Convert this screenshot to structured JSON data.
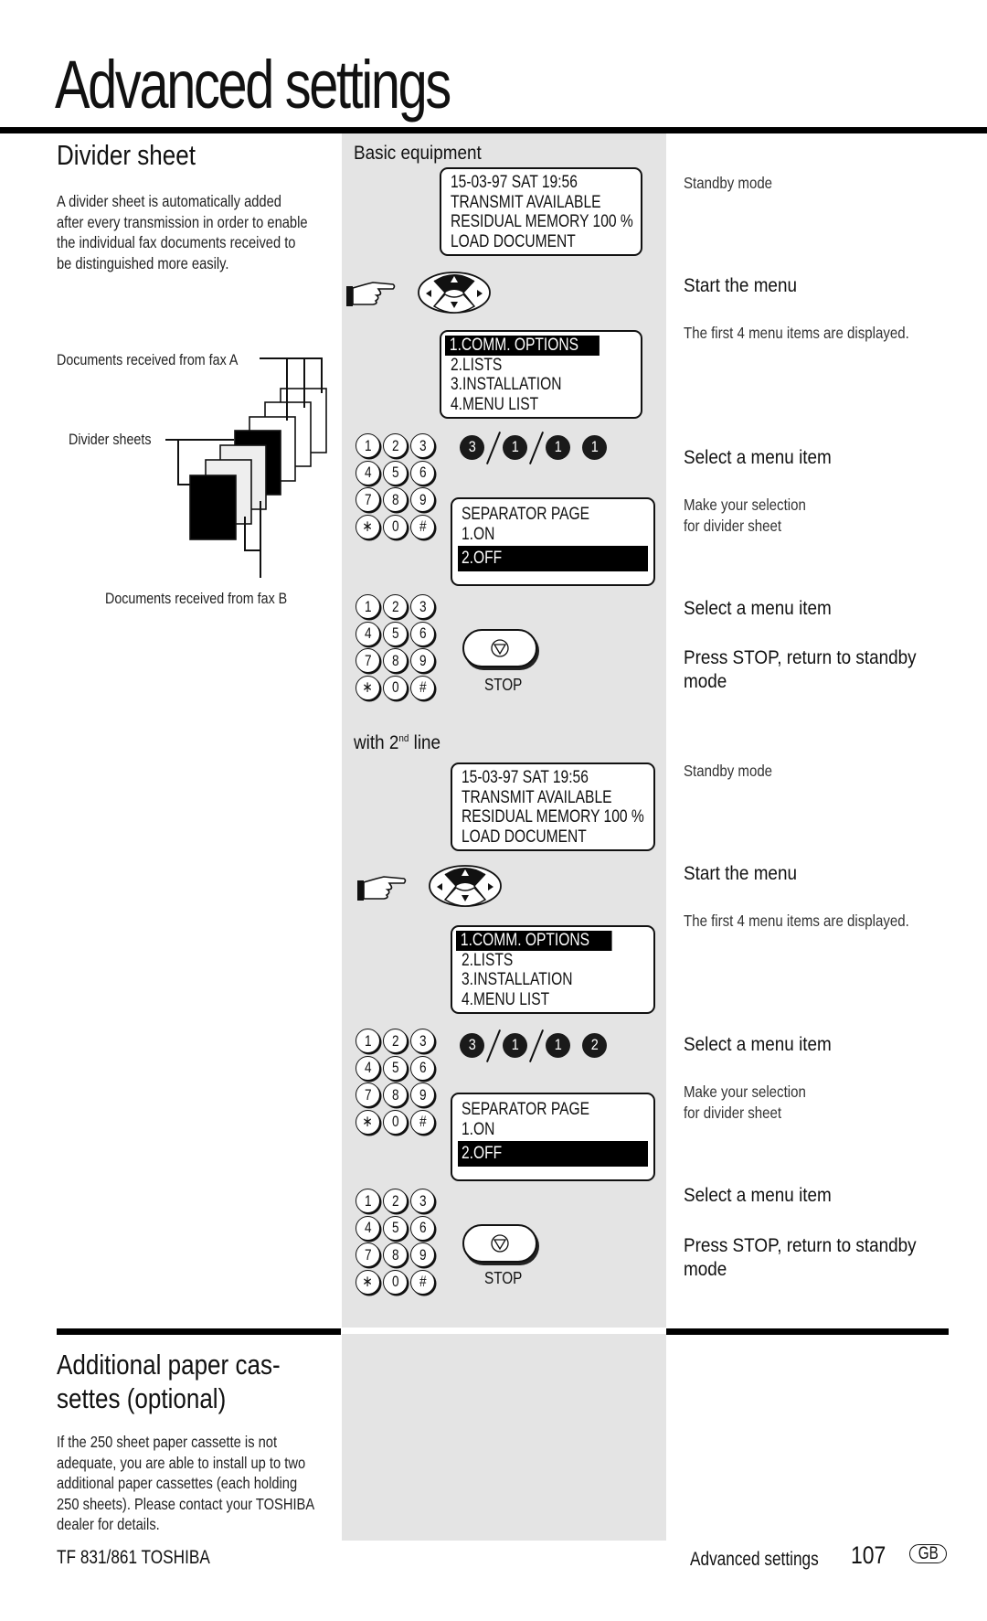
{
  "page": {
    "title": "Advanced settings",
    "footer": {
      "left": "TF 831/861 TOSHIBA",
      "section": "Advanced settings",
      "page_number": "107",
      "lang_badge": "GB"
    }
  },
  "divider_sheet": {
    "heading": "Divider sheet",
    "paragraph": [
      "A divider sheet is automatically added",
      "after every transmission in order to enable",
      "the individual fax documents received to",
      "be distinguished more easily."
    ],
    "diagram": {
      "label_fax_a": "Documents received from fax A",
      "label_dividers": "Divider sheets",
      "label_fax_b": "Documents received from fax B"
    }
  },
  "additional_cassettes": {
    "heading_lines": [
      "Additional paper cas-",
      "settes (optional)"
    ],
    "paragraph": [
      "If the 250 sheet paper cassette is not",
      "adequate, you are able to install up to two",
      "additional paper cassettes (each holding",
      "250 sheets). Please contact your TOSHIBA",
      "dealer for details."
    ]
  },
  "procedures": [
    {
      "heading": "Basic equipment",
      "heading_sup": "",
      "standby_lcd": [
        "15-03-97    SAT    19:56",
        "TRANSMIT AVAILABLE",
        "RESIDUAL MEMORY 100 %",
        "LOAD DOCUMENT"
      ],
      "menu_lcd": [
        "1.COMM. OPTIONS",
        "2.LISTS",
        "3.INSTALLATION",
        "4.MENU LIST"
      ],
      "menu_highlight_index": 0,
      "key_sequence": [
        "3",
        "/",
        "1",
        "/",
        "1",
        "1"
      ],
      "separator_lcd": {
        "title": "SEPARATOR PAGE",
        "options": [
          "1.ON",
          "2.OFF"
        ],
        "selected_index": 1
      },
      "stop_label": "STOP",
      "steps": {
        "standby": "Standby mode",
        "start_menu": "Start the menu",
        "first_four": "The first 4 menu items are displayed.",
        "select_item_1": "Select a menu item",
        "make_selection": [
          "Make your selection",
          "for divider sheet"
        ],
        "select_item_2": "Select a menu item",
        "press_stop": [
          "Press STOP, return to standby",
          "mode"
        ]
      }
    },
    {
      "heading": "with 2",
      "heading_sup": "nd",
      "heading_tail": " line",
      "standby_lcd": [
        "15-03-97    SAT    19:56",
        "TRANSMIT AVAILABLE",
        "RESIDUAL MEMORY 100 %",
        "LOAD DOCUMENT"
      ],
      "menu_lcd": [
        "1.COMM. OPTIONS",
        "2.LISTS",
        "3.INSTALLATION",
        "4.MENU LIST"
      ],
      "menu_highlight_index": 0,
      "key_sequence": [
        "3",
        "/",
        "1",
        "/",
        "1",
        "2"
      ],
      "separator_lcd": {
        "title": "SEPARATOR PAGE",
        "options": [
          "1.ON",
          "2.OFF"
        ],
        "selected_index": 1
      },
      "stop_label": "STOP",
      "steps": {
        "standby": "Standby mode",
        "start_menu": "Start the menu",
        "first_four": "The first 4 menu items are displayed.",
        "select_item_1": "Select a menu item",
        "make_selection": [
          "Make your selection",
          "for divider sheet"
        ],
        "select_item_2": "Select a menu item",
        "press_stop": [
          "Press STOP, return to standby",
          "mode"
        ]
      }
    }
  ],
  "keypad_keys": [
    "1",
    "2",
    "3",
    "4",
    "5",
    "6",
    "7",
    "8",
    "9",
    "∗",
    "0",
    "#"
  ],
  "icons": {
    "hand": "pointing-hand-icon",
    "nav": "navigation-pad-icon",
    "stop": "stop-triangle-icon"
  },
  "colors": {
    "gray_column": "#e4e4e4",
    "ink": "#111111"
  }
}
